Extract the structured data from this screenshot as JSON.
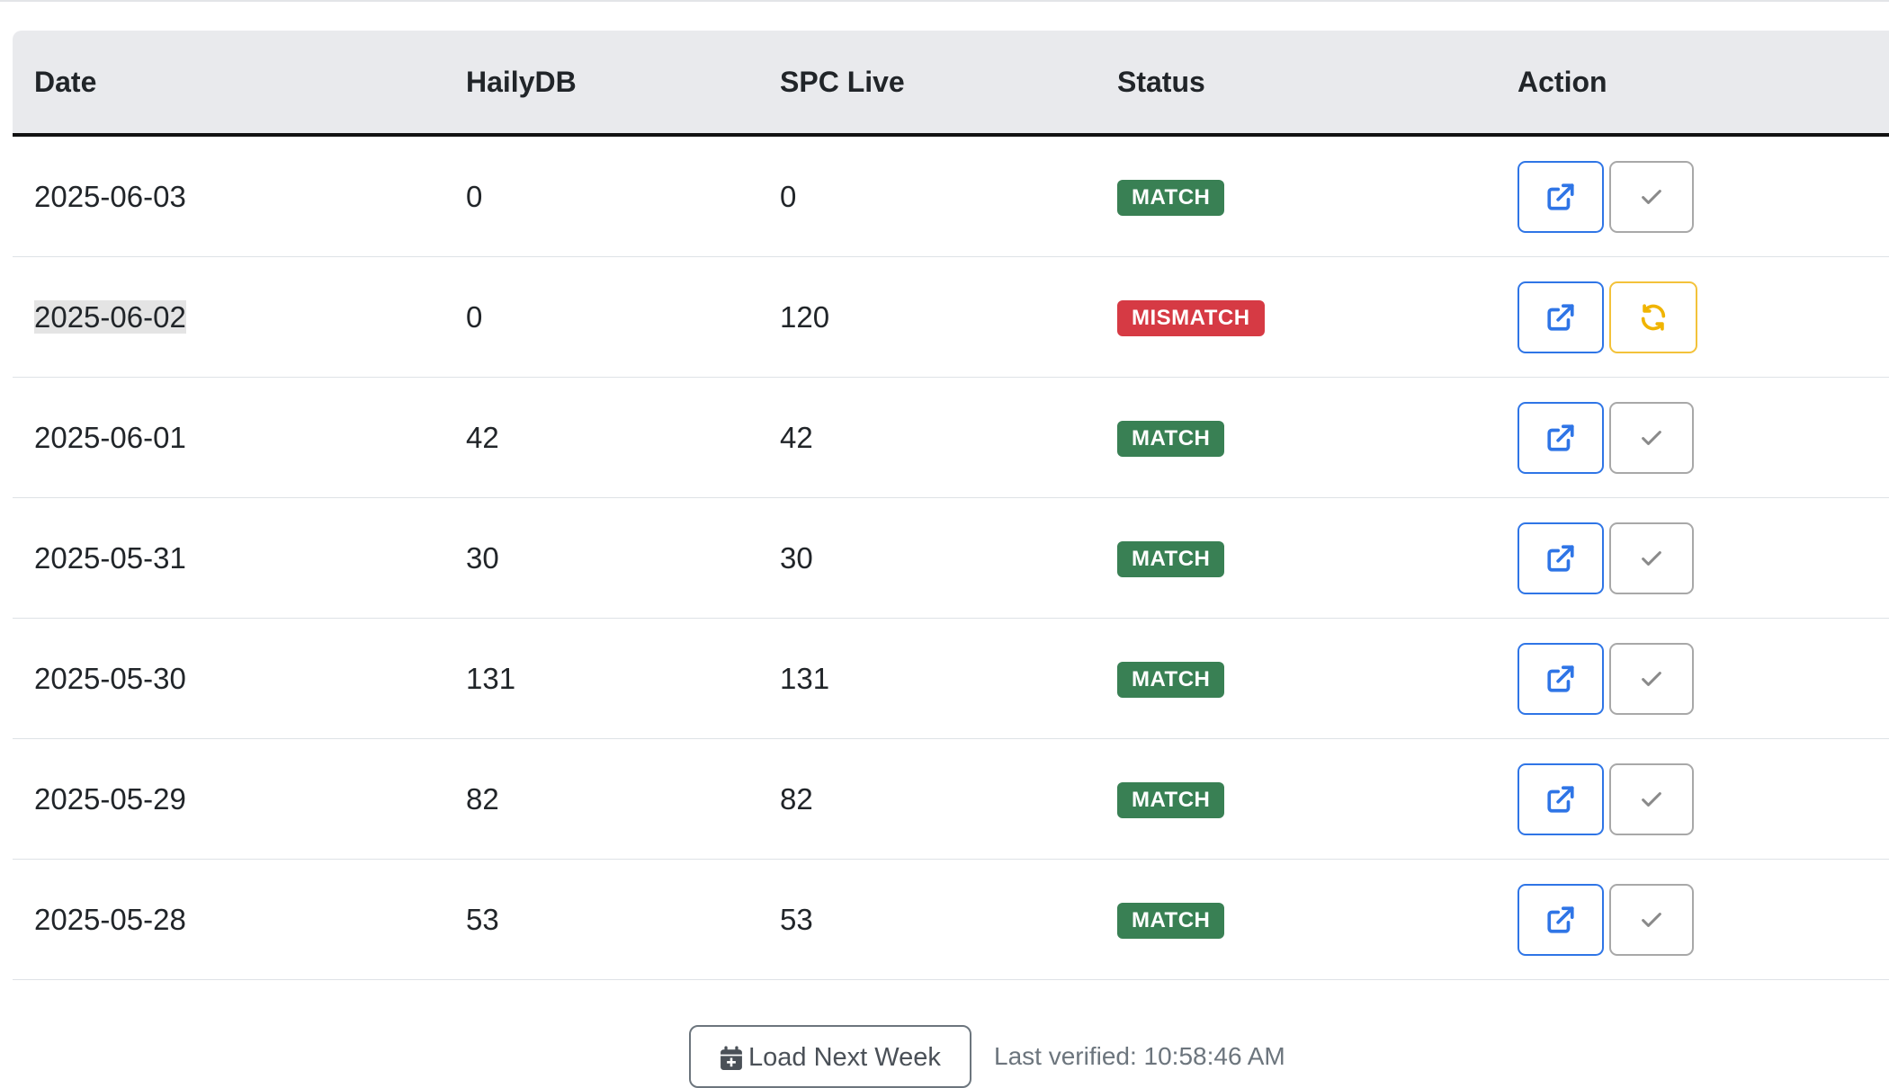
{
  "table": {
    "headers": {
      "date": "Date",
      "hailydb": "HailyDB",
      "spc_live": "SPC Live",
      "status": "Status",
      "action": "Action"
    },
    "rows": [
      {
        "date": "2025-06-03",
        "hailydb": "0",
        "spc_live": "0",
        "status": "MATCH"
      },
      {
        "date": "2025-06-02",
        "hailydb": "0",
        "spc_live": "120",
        "status": "MISMATCH"
      },
      {
        "date": "2025-06-01",
        "hailydb": "42",
        "spc_live": "42",
        "status": "MATCH"
      },
      {
        "date": "2025-05-31",
        "hailydb": "30",
        "spc_live": "30",
        "status": "MATCH"
      },
      {
        "date": "2025-05-30",
        "hailydb": "131",
        "spc_live": "131",
        "status": "MATCH"
      },
      {
        "date": "2025-05-29",
        "hailydb": "82",
        "spc_live": "82",
        "status": "MATCH"
      },
      {
        "date": "2025-05-28",
        "hailydb": "53",
        "spc_live": "53",
        "status": "MATCH"
      }
    ]
  },
  "footer": {
    "load_next_week": "Load Next Week",
    "last_verified": "Last verified: 10:58:46 AM"
  },
  "icons": {
    "open": "external-link-icon",
    "confirmed": "check-icon",
    "resync": "sync-icon",
    "load": "calendar-plus-icon"
  },
  "colors": {
    "match": "#398054",
    "mismatch": "#d63a44",
    "primary": "#2f75e6",
    "warning": "#f3c23a"
  }
}
